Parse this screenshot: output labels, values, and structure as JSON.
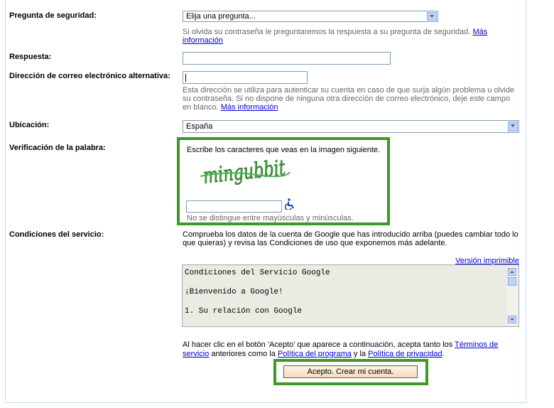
{
  "security_question": {
    "label": "Pregunta de seguridad:",
    "selected": "Elija una pregunta...",
    "help_text": "Si olvida su contraseña le preguntaremos la respuesta a su pregunta de seguridad. ",
    "help_link": "Más información"
  },
  "answer": {
    "label": "Respuesta:",
    "value": ""
  },
  "alt_email": {
    "label": "Dirección de correo electrónico alternativa:",
    "value": "",
    "help_text": "Esta dirección se utiliza para autenticar su cuenta en caso de que surja algún problema u olvide su contraseña. Si no dispone de ninguna otra dirección de correo electrónico, deje este campo en blanco. ",
    "help_link": "Más información"
  },
  "location": {
    "label": "Ubicación:",
    "selected": "España"
  },
  "word_verification": {
    "label": "Verificación de la palabra:",
    "instruction": "Escribe los caracteres que veas en la imagen siguiente.",
    "captcha_text": "mingubbit",
    "value": "",
    "accessibility_icon": "wheelchair-icon",
    "note": "No se distingue entre mayúsculas y minúsculas."
  },
  "terms": {
    "label": "Condiciones del servicio:",
    "intro": "Comprueba los datos de la cuenta de Google que has introducido arriba (puedes cambiar todo lo que quieras) y revisa las Condiciones de uso que exponemos más adelante.",
    "printable_link": "Versión imprimible",
    "box_lines": [
      "Condiciones del Servicio Google",
      "¡Bienvenido a Google!",
      "1. Su relación con Google"
    ],
    "accept_text_1": "Al hacer clic en el botón 'Acepto' que aparece a continuación, acepta tanto los ",
    "link_terms": "Términos de servicio",
    "accept_text_2": " anteriores como la ",
    "link_program": "Política del programa",
    "accept_text_3": " y la ",
    "link_privacy": "Política de privacidad",
    "accept_text_4": "."
  },
  "accept_button": "Acepto. Crear mi cuenta.",
  "colors": {
    "highlight": "#3b9a1f",
    "link": "#0000cc",
    "border": "#c3d9ff"
  }
}
